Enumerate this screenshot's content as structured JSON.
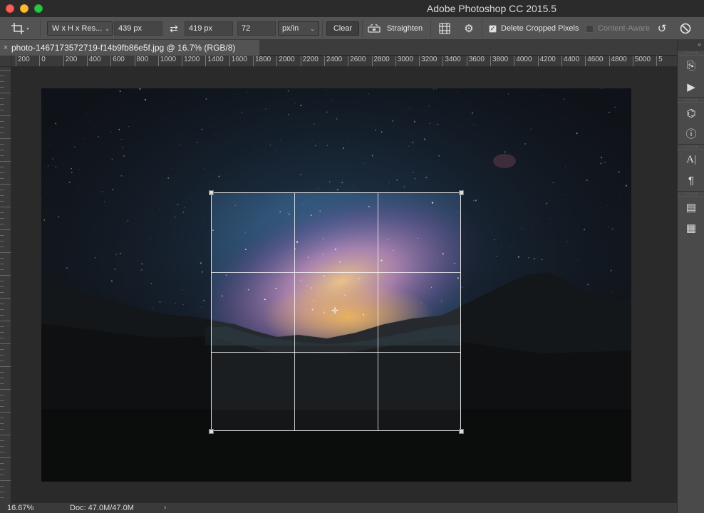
{
  "window": {
    "title": "Adobe Photoshop CC 2015.5"
  },
  "options": {
    "ratio_preset": "W x H x Res...",
    "width": "439 px",
    "swap_icon": "swap-arrows-icon",
    "height": "419 px",
    "resolution": "72",
    "resolution_unit": "px/in",
    "clear_label": "Clear",
    "straighten_label": "Straighten",
    "delete_cropped_label": "Delete Cropped Pixels",
    "delete_cropped_checked": true,
    "content_aware_label": "Content-Aware",
    "content_aware_checked": false
  },
  "document": {
    "tab_label": "photo-1467173572719-f14b9fb86e5f.jpg @ 16.7% (RGB/8)"
  },
  "ruler": {
    "h_labels": [
      "200",
      "0",
      "200",
      "400",
      "600",
      "800",
      "1000",
      "1200",
      "1400",
      "1600",
      "1800",
      "2000",
      "2200",
      "2400",
      "2600",
      "2800",
      "3000",
      "3200",
      "3400",
      "3600",
      "3800",
      "4000",
      "4200",
      "4400",
      "4600",
      "4800",
      "5000",
      "5"
    ]
  },
  "status": {
    "zoom": "16.67%",
    "doc_info": "Doc: 47.0M/47.0M"
  },
  "colors": {
    "chrome": "#535353",
    "sky_core": "#2a4f7a",
    "galaxy": "#c88ab8",
    "glow": "#e0a84e"
  }
}
